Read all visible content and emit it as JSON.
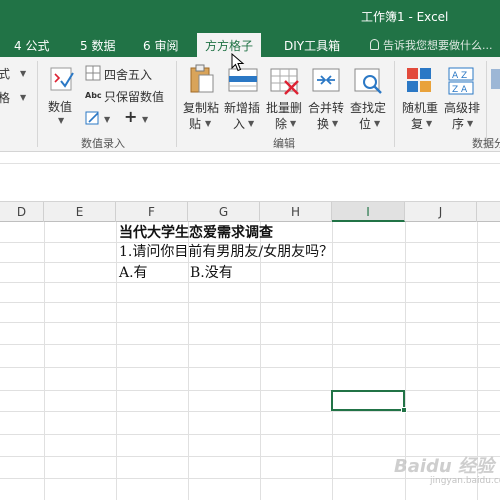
{
  "window": {
    "title": "工作簿1 - Excel"
  },
  "tabs": [
    {
      "label": "4 公式",
      "active": false
    },
    {
      "label": "5 数据",
      "active": false
    },
    {
      "label": "6 审阅",
      "active": false
    },
    {
      "label": "方方格子",
      "active": true
    },
    {
      "label": "DIY工具箱",
      "active": false
    }
  ],
  "tell_me": {
    "placeholder": "告诉我您想要做什么..."
  },
  "ribbon": {
    "partial_left": {
      "item1": "式",
      "item2": "格"
    },
    "data_entry": {
      "numeric_label": "数值",
      "round_label": "四舍五入",
      "keep_values_label": "只保留数值",
      "plus_label": "+",
      "group_label": "数值录入"
    },
    "edit": {
      "copy_paste": {
        "line1": "复制粘",
        "line2": "贴"
      },
      "insert": {
        "line1": "新增插",
        "line2": "入"
      },
      "batch_delete": {
        "line1": "批量删",
        "line2": "除"
      },
      "merge_convert": {
        "line1": "合并转",
        "line2": "换"
      },
      "find_locate": {
        "line1": "查找定",
        "line2": "位"
      },
      "group_label": "编辑"
    },
    "data_analysis": {
      "random_dup": {
        "line1": "随机重",
        "line2": "复"
      },
      "advanced_sort": {
        "line1": "高级排",
        "line2": "序"
      },
      "group_label": "数据分"
    }
  },
  "sheet": {
    "columns": [
      "D",
      "E",
      "F",
      "G",
      "H",
      "I",
      "J"
    ],
    "selected_column": "I",
    "cells": {
      "title": "当代大学生恋爱需求调查",
      "question": "1.请问你目前有男朋友/女朋友吗？",
      "option_a": "A.有",
      "option_b": "B.没有"
    }
  },
  "watermark": {
    "main": "Baidu 经验",
    "sub": "jingyan.baidu.com"
  },
  "colors": {
    "excel_green": "#217346",
    "ribbon_bg": "#f3f3f3"
  }
}
